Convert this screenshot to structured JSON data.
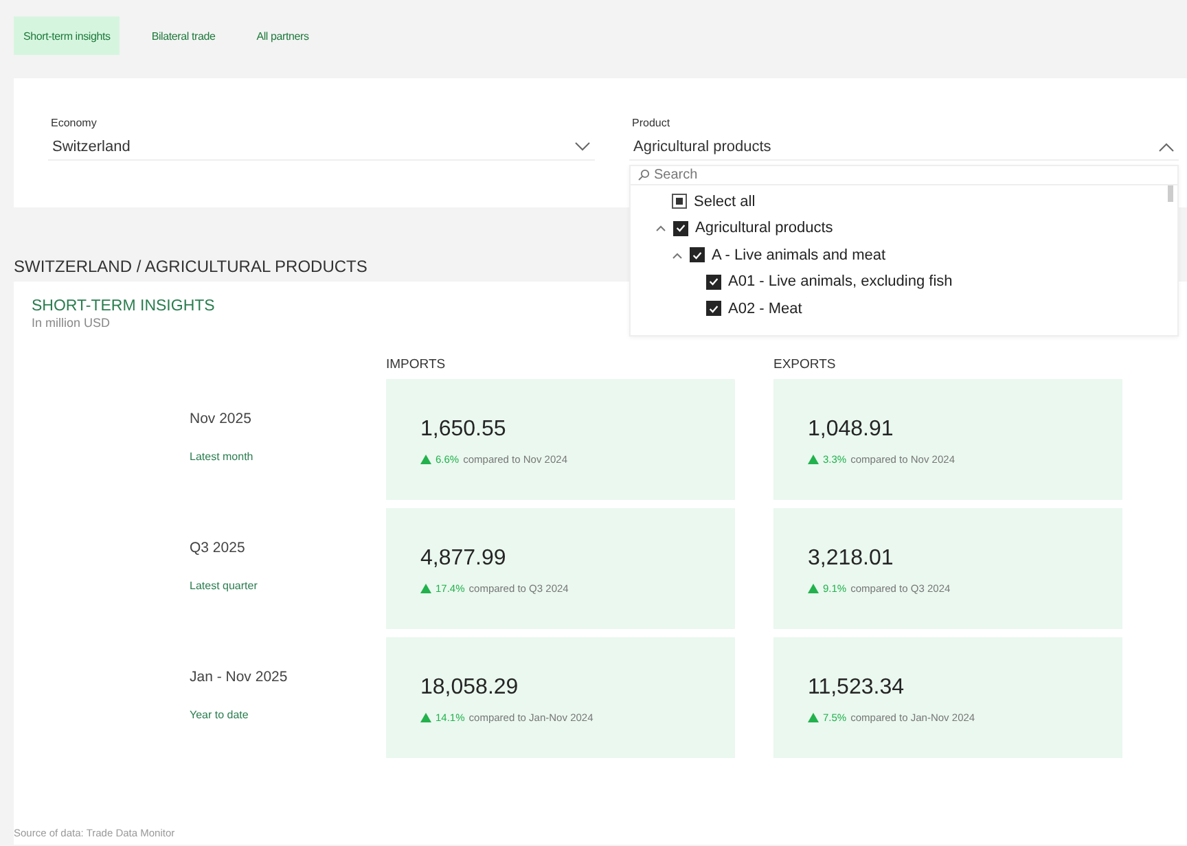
{
  "tabs": [
    {
      "label": "Short-term insights",
      "selected": true
    },
    {
      "label": "Bilateral trade",
      "selected": false
    },
    {
      "label": "All partners",
      "selected": false
    }
  ],
  "filters": {
    "economy": {
      "label": "Economy",
      "value": "Switzerland",
      "expanded": false
    },
    "product": {
      "label": "Product",
      "value": "Agricultural products",
      "expanded": true,
      "search": {
        "placeholder": "Search"
      },
      "select_all": {
        "label": "Select all",
        "partial": true
      },
      "items": [
        {
          "label": "Agricultural products",
          "checked": true,
          "expanded": true,
          "children": [
            {
              "label": "A - Live animals and meat",
              "checked": true,
              "expanded": true,
              "children": [
                {
                  "label": "A01 - Live animals, excluding fish",
                  "checked": true
                },
                {
                  "label": "A02 - Meat",
                  "checked": true
                }
              ]
            }
          ]
        }
      ]
    }
  },
  "breadcrumb": "SWITZERLAND / AGRICULTURAL PRODUCTS",
  "insights": {
    "title": "SHORT-TERM INSIGHTS",
    "subtitle": "In million USD",
    "columns": [
      "IMPORTS",
      "EXPORTS"
    ],
    "rows": [
      {
        "period": "Nov 2025",
        "caption": "Latest month",
        "cells": [
          {
            "value": "1,650.55",
            "rising": true,
            "change": "6.6%",
            "comparison": "compared to Nov 2024"
          },
          {
            "value": "1,048.91",
            "rising": true,
            "change": "3.3%",
            "comparison": "compared to Nov 2024"
          }
        ]
      },
      {
        "period": "Q3 2025",
        "caption": "Latest quarter",
        "cells": [
          {
            "value": "4,877.99",
            "rising": true,
            "change": "17.4%",
            "comparison": "compared to Q3 2024"
          },
          {
            "value": "3,218.01",
            "rising": true,
            "change": "9.1%",
            "comparison": "compared to Q3 2024"
          }
        ]
      },
      {
        "period": "Jan - Nov 2025",
        "caption": "Year to date",
        "cells": [
          {
            "value": "18,058.29",
            "rising": true,
            "change": "14.1%",
            "comparison": "compared to Jan-Nov 2024"
          },
          {
            "value": "11,523.34",
            "rising": true,
            "change": "7.5%",
            "comparison": "compared to Jan-Nov 2024"
          }
        ]
      }
    ]
  },
  "source": "Source of data: Trade Data Monitor"
}
